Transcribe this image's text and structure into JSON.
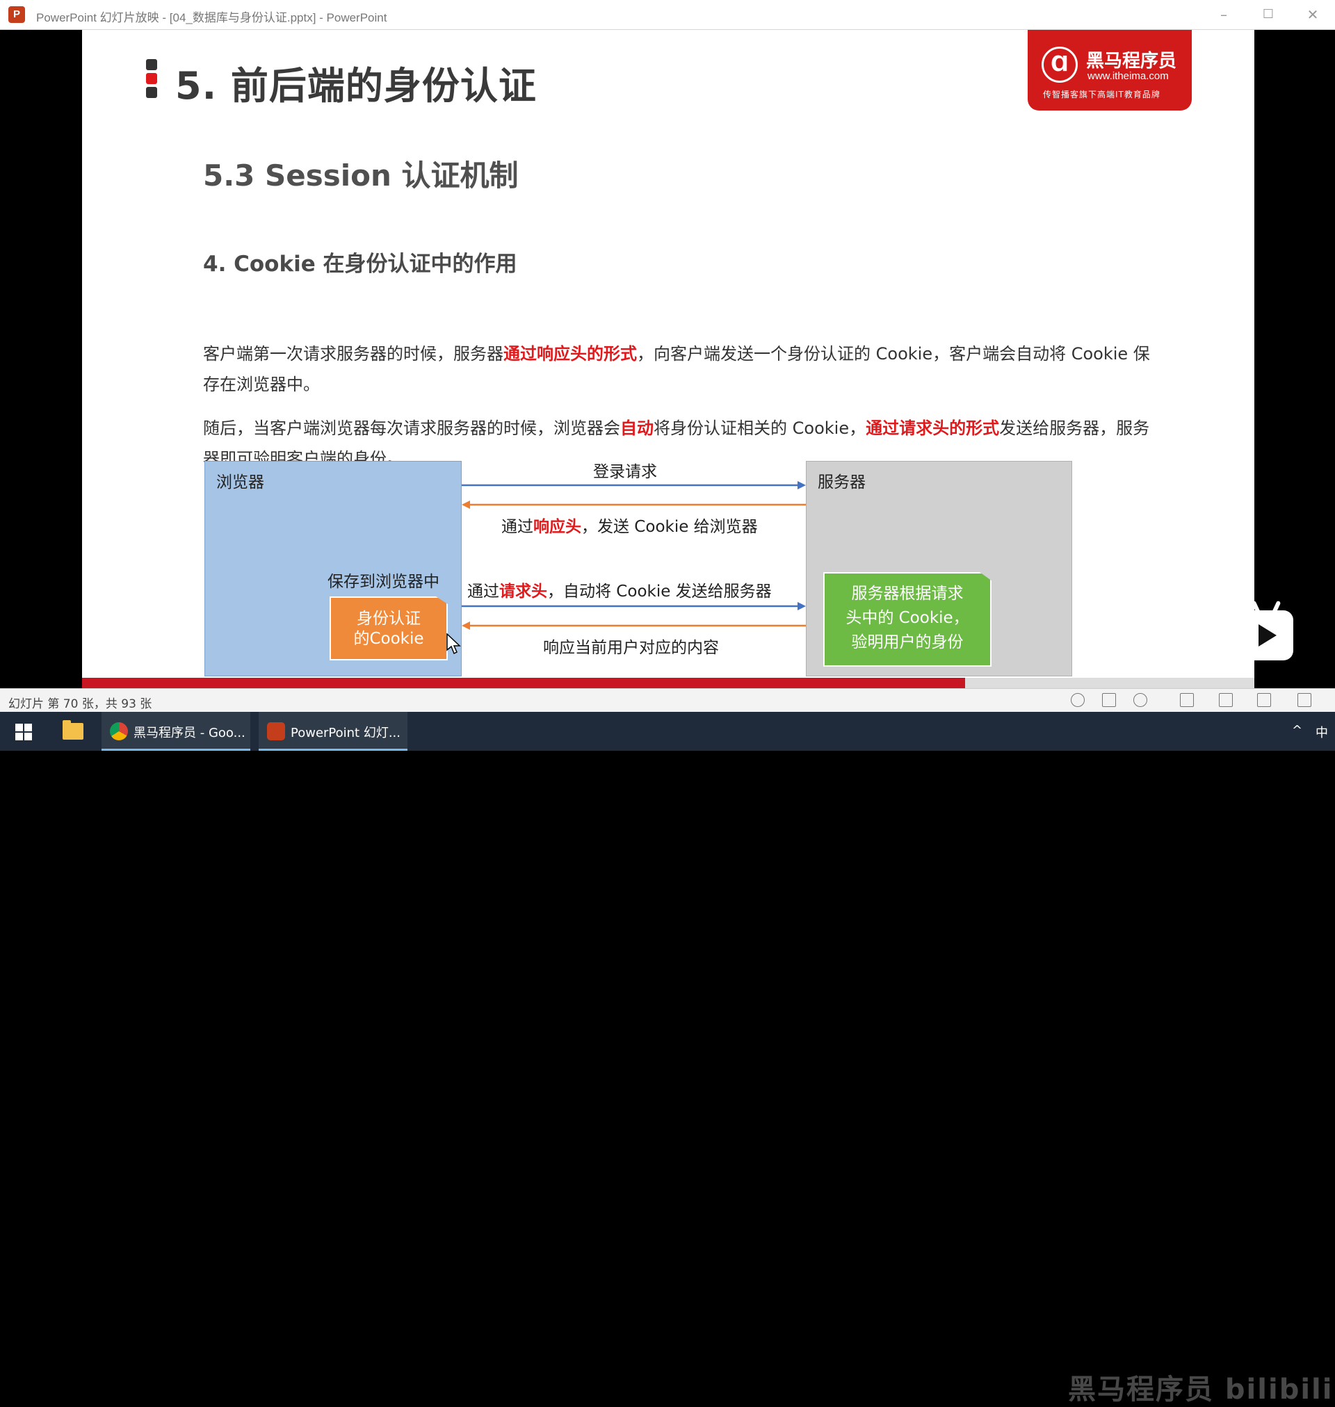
{
  "window": {
    "app_icon": "P",
    "title": "PowerPoint 幻灯片放映 - [04_数据库与身份认证.pptx] - PowerPoint",
    "minimize": "–",
    "maximize": "☐",
    "close": "✕"
  },
  "slide": {
    "title": "5. 前后端的身份认证",
    "logo": {
      "mark": "Ɑ",
      "brand": "黑马程序员",
      "url": "www.itheima.com",
      "slogan": "传智播客旗下高端IT教育品牌"
    },
    "subtitle": "5.3 Session 认证机制",
    "section": "4. Cookie 在身份认证中的作用",
    "para1": {
      "part1": "客户端第一次请求服务器的时候，服务器",
      "hl1": "通过响应头的形式",
      "part2": "，向客户端发送一个身份认证的 Cookie，客户端会自动将 Cookie 保存在浏览器中。"
    },
    "para2": {
      "part1": "随后，当客户端浏览器每次请求服务器的时候，浏览器会",
      "hl1": "自动",
      "part2": "将身份认证相关的 Cookie，",
      "hl2": "通过请求头的形式",
      "part3": "发送给服务器，服务器即可验明客户端的身份。"
    },
    "diagram": {
      "browser_label": "浏览器",
      "server_label": "服务器",
      "save_label": "保存到浏览器中",
      "cookie_box": {
        "line1": "身份认证",
        "line2": "的Cookie"
      },
      "server_note": {
        "line1": "服务器根据请求",
        "line2": "头中的 Cookie，",
        "line3": "验明用户的身份"
      },
      "arrow1": "登录请求",
      "arrow2": {
        "pre": "通过",
        "hl": "响应头",
        "post": "，发送 Cookie 给浏览器"
      },
      "arrow3": {
        "pre": "通过",
        "hl": "请求头",
        "post": "，自动将 Cookie 发送给服务器"
      },
      "arrow4": "响应当前用户对应的内容"
    },
    "progress": 0.753
  },
  "status": {
    "slide_info": "幻灯片 第 70 张，共 93 张",
    "watermark": "黑马程序员 bilibili"
  },
  "taskbar": {
    "chrome_label": "黑马程序员 - Goo...",
    "ppt_label": "PowerPoint 幻灯...",
    "ime": "中",
    "tray_arrow": "^"
  },
  "colors": {
    "accent_red": "#e0191c",
    "brand_red": "#d11a1a",
    "arrow_blue": "#4472c4",
    "arrow_orange": "#ed7d31",
    "browser_blue": "#a6c4e6",
    "server_gray": "#d0d0d0",
    "cookie_orange": "#f08a3b",
    "note_green": "#6dbb45"
  }
}
